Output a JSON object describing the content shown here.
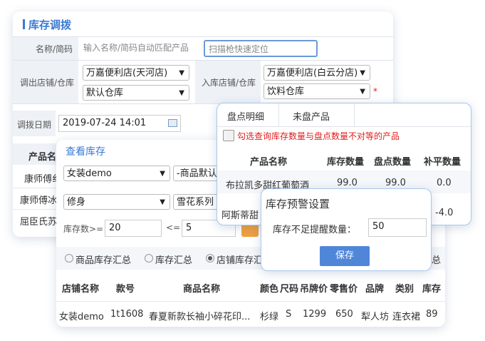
{
  "transfer": {
    "title": "库存调拨",
    "name_label": "名称/简码",
    "name_placeholder": "输入名称/简码自动匹配产品",
    "scan_placeholder": "扫描枪快速定位",
    "out_label": "调出店铺/仓库",
    "out_store": "万嘉便利店(天河店)",
    "out_warehouse": "默认仓库",
    "in_label": "入库店铺/仓库",
    "in_store": "万嘉便利店(白云分店)",
    "in_warehouse": "饮料仓库",
    "required_mark": "*",
    "date_label": "调拨日期",
    "date_value": "2019-07-24 14:01",
    "col_product": "产品名",
    "rows": [
      "康师傅纟",
      "康师傅冰",
      "屈臣氏苏"
    ]
  },
  "view_stock": {
    "title": "查看库存",
    "category": "女装demo",
    "product_default": "-商品默认",
    "style": "修身",
    "series": "雪花系列",
    "stock_gte_label": "库存数>=",
    "stock_gte_value": "20",
    "stock_lte_label": "<=",
    "stock_lte_value": "5",
    "radios": [
      "商品库存汇总",
      "库存汇总",
      "店铺库存汇"
    ],
    "radio_selected": 2,
    "radio_extra": "总",
    "columns": [
      "店铺名称",
      "款号",
      "商品名称",
      "颜色",
      "尺码",
      "吊牌价",
      "零售价",
      "品牌",
      "类别",
      "库存"
    ],
    "row": [
      "女装demo",
      "1t1608",
      "春夏新款长袖小碎花印...",
      "杉绿",
      "S",
      "1299",
      "650",
      "犁人坊",
      "连衣裙",
      "89"
    ]
  },
  "inventory_check": {
    "tabs": [
      "盘点明细",
      "未盘产品"
    ],
    "checkbox_label": "勾选查询库存数量与盘点数量不对等的产品",
    "columns": [
      "产品名称",
      "库存数量",
      "盘点数量",
      "补平数量"
    ],
    "rows": [
      [
        "布拉凯多甜红葡萄酒",
        "99.0",
        "99.0",
        "0.0"
      ],
      [
        "阿斯蒂甜",
        "",
        "",
        "-4.0"
      ]
    ]
  },
  "alert": {
    "title": "库存预警设置",
    "label": "库存不足提醒数量：",
    "value": "50",
    "save": "保存"
  },
  "colors": {
    "accent": "#3a7ad4",
    "header_bg": "#eef2f7",
    "save_btn": "#4f86d8",
    "required": "#e02020"
  }
}
